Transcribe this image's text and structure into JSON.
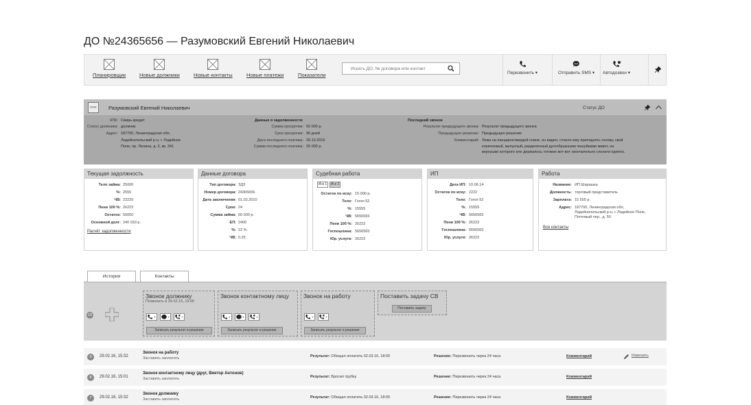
{
  "page": {
    "title": "ДО №24365656 — Разумовский Евгений Николаевич"
  },
  "nav": {
    "items": [
      {
        "label": "Планировщик"
      },
      {
        "label": "Новые должники"
      },
      {
        "label": "Новые контакты"
      },
      {
        "label": "Новые платежи"
      },
      {
        "label": "Показатели"
      }
    ],
    "search_placeholder": "Искать ДО, № договора или контакт",
    "call_label": "Перезвонить ▾",
    "sms_label": "Отправить SMS ▾",
    "autodial_label": "Автодозвон ▾"
  },
  "profile": {
    "avatar": "icon",
    "name": "Разумовский Евгений Николаевич",
    "status": "Статус ДО",
    "kpk_k": "КПК:",
    "kpk_v": "Свирь-кредит",
    "dstatus_k": "Статус должника:",
    "dstatus_v": "должник",
    "addr_k": "Адрес:",
    "addr_l1": "187700, Ленинградская обл,",
    "addr_l2": "Лодейнопольский р-н, г. Лодейное",
    "addr_l3": "Поле, пр. Ленина, д. 3, кв. 341",
    "debt_head": "Данные о задолженности",
    "overdue_sum_k": "Сумма просрочки:",
    "overdue_sum_v": "50 000 р.",
    "overdue_term_k": "Срок просрочки:",
    "overdue_term_v": "96 дней",
    "last_pay_date_k": "Дата последнего платежа:",
    "last_pay_date_v": "20.10.2015",
    "last_pay_sum_k": "Сумма последнего платежа:",
    "last_pay_sum_v": "25 000 р.",
    "call_head": "Последний звонок",
    "prev_result_k": "Результат предыдущего звонка:",
    "prev_result_v": "Результат предыдущего звонка",
    "prev_decision_k": "Предыдущее решение:",
    "prev_decision_v": "Предыдущее решение",
    "comment_k": "Комментарий:",
    "comment_l1": "Лежа на панцирнотвердой спине, он видел, стоило ему приподнять голову, свой",
    "comment_l2": "коричневый, выпуклый, разделенный дугообразными чешуйками живот, на",
    "comment_l3": "верхушке которого еле держалось готовое вот-вот окончательно сползти одеяло."
  },
  "cards": {
    "debt": {
      "title": "Текущая задолжность",
      "rows": [
        {
          "k": "Тело займа:",
          "v": "25000"
        },
        {
          "k": "%:",
          "v": "2555"
        },
        {
          "k": "ЧВ:",
          "v": "23225"
        },
        {
          "k": "Пени 100 %:",
          "v": "26222"
        },
        {
          "k": "Остаток:",
          "v": "50000"
        },
        {
          "k": "Основной долг:",
          "v": "240 033 р."
        }
      ],
      "link": "Расчёт задолженности"
    },
    "contract": {
      "title": "Данные договора",
      "rows": [
        {
          "k": "Тип договора:",
          "v": "ЗДЗ"
        },
        {
          "k": "Номер договора:",
          "v": "24365656"
        },
        {
          "k": "Дата заключения:",
          "v": "01.02.2010"
        },
        {
          "k": "Срок:",
          "v": "24"
        },
        {
          "k": "Сумма займа:",
          "v": "50 000 р."
        },
        {
          "k": "ЕП:",
          "v": "2400"
        },
        {
          "k": "%:",
          "v": "22 %"
        },
        {
          "k": "ЧВ:",
          "v": "0.25"
        }
      ]
    },
    "court": {
      "title": "Судебная работа",
      "tab1": "Иск 1",
      "tab2": "Иск 2",
      "rows": [
        {
          "k": "Остаток по иску:",
          "v": "15 000 р."
        },
        {
          "k": "Тело:",
          "v": "Гогол 52"
        },
        {
          "k": "%:",
          "v": "15555"
        },
        {
          "k": "ЧВ:",
          "v": "5656565"
        },
        {
          "k": "Пени 100 %:",
          "v": "26222"
        },
        {
          "k": "Госпошлина:",
          "v": "5656565"
        },
        {
          "k": "Юр. услуги:",
          "v": "26222"
        }
      ]
    },
    "ip": {
      "title": "ИП",
      "rows": [
        {
          "k": "Дата ИП:",
          "v": "10.06.14"
        },
        {
          "k": "Остаток по иску:",
          "v": "2222"
        },
        {
          "k": "Тело:",
          "v": "Гогол 52"
        },
        {
          "k": "%:",
          "v": "15555"
        },
        {
          "k": "ЧВ:",
          "v": "5656565"
        },
        {
          "k": "Пени 100 %:",
          "v": "26222"
        },
        {
          "k": "Госпошлина:",
          "v": "5656565"
        },
        {
          "k": "Юр. услуги:",
          "v": "26222"
        }
      ]
    },
    "work": {
      "title": "Работа",
      "name_k": "Название:",
      "name_v": "ИП Шарашка",
      "pos_k": "Должность:",
      "pos_v": "торговый представитель",
      "sal_k": "Зарплата:",
      "sal_v": "15 555 р.",
      "addr_k": "Адрес:",
      "addr_l1": "187700, Ленинградская обл,",
      "addr_l2": "Лодейнопольский р-н, г. Лодейное Поле,",
      "addr_l3": "Почтовый пер., д. 50",
      "link": "Все контакты"
    }
  },
  "tabs": {
    "history": "История",
    "contacts": "Контакты"
  },
  "actions": {
    "count": "10",
    "debtor": {
      "title": "Звонок должнику",
      "sub": "Позвонить в 30.02.16, 19:00",
      "btn": "Записать результат и решение"
    },
    "contact": {
      "title": "Звонок контактному лицу",
      "btn": "Записать результат и решение"
    },
    "work": {
      "title": "Звонок на работу",
      "btn": "Записать результат и решение"
    },
    "task": {
      "title": "Поставить задачу СВ",
      "btn": "Поставить задачу"
    }
  },
  "history": [
    {
      "num": "9",
      "date": "29.02.16, 15:32",
      "title": "Звонок на работу",
      "sub": "Заставить заплатить",
      "result_k": "Результат:",
      "result_v": "Обещал оплатить 02.03.16, 18:00",
      "decision_k": "Решение:",
      "decision_v": "Перезвонить через 24 часа",
      "comment": "Комментарий",
      "edit": "Изменить"
    },
    {
      "num": "8",
      "date": "29.02.16, 15:01",
      "title": "Звонок контактному лицу (друг, Виктор Антонов)",
      "sub": "Заставить заплатить",
      "result_k": "Результат:",
      "result_v": "Бросил трубку",
      "decision_k": "Решение:",
      "decision_v": "Перезвонить через 24 часа",
      "comment": "Комментарий"
    },
    {
      "num": "7",
      "date": "29.02.16, 15:32",
      "title": "Звонок должнику",
      "sub": "Заставить заплатить",
      "result_k": "Результат:",
      "result_v": "Обещал оплатить 02.03.16, 18:00",
      "decision_k": "Решение:",
      "decision_v": "Перезвонить через 24 часа",
      "comment": "Комментарий"
    }
  ]
}
